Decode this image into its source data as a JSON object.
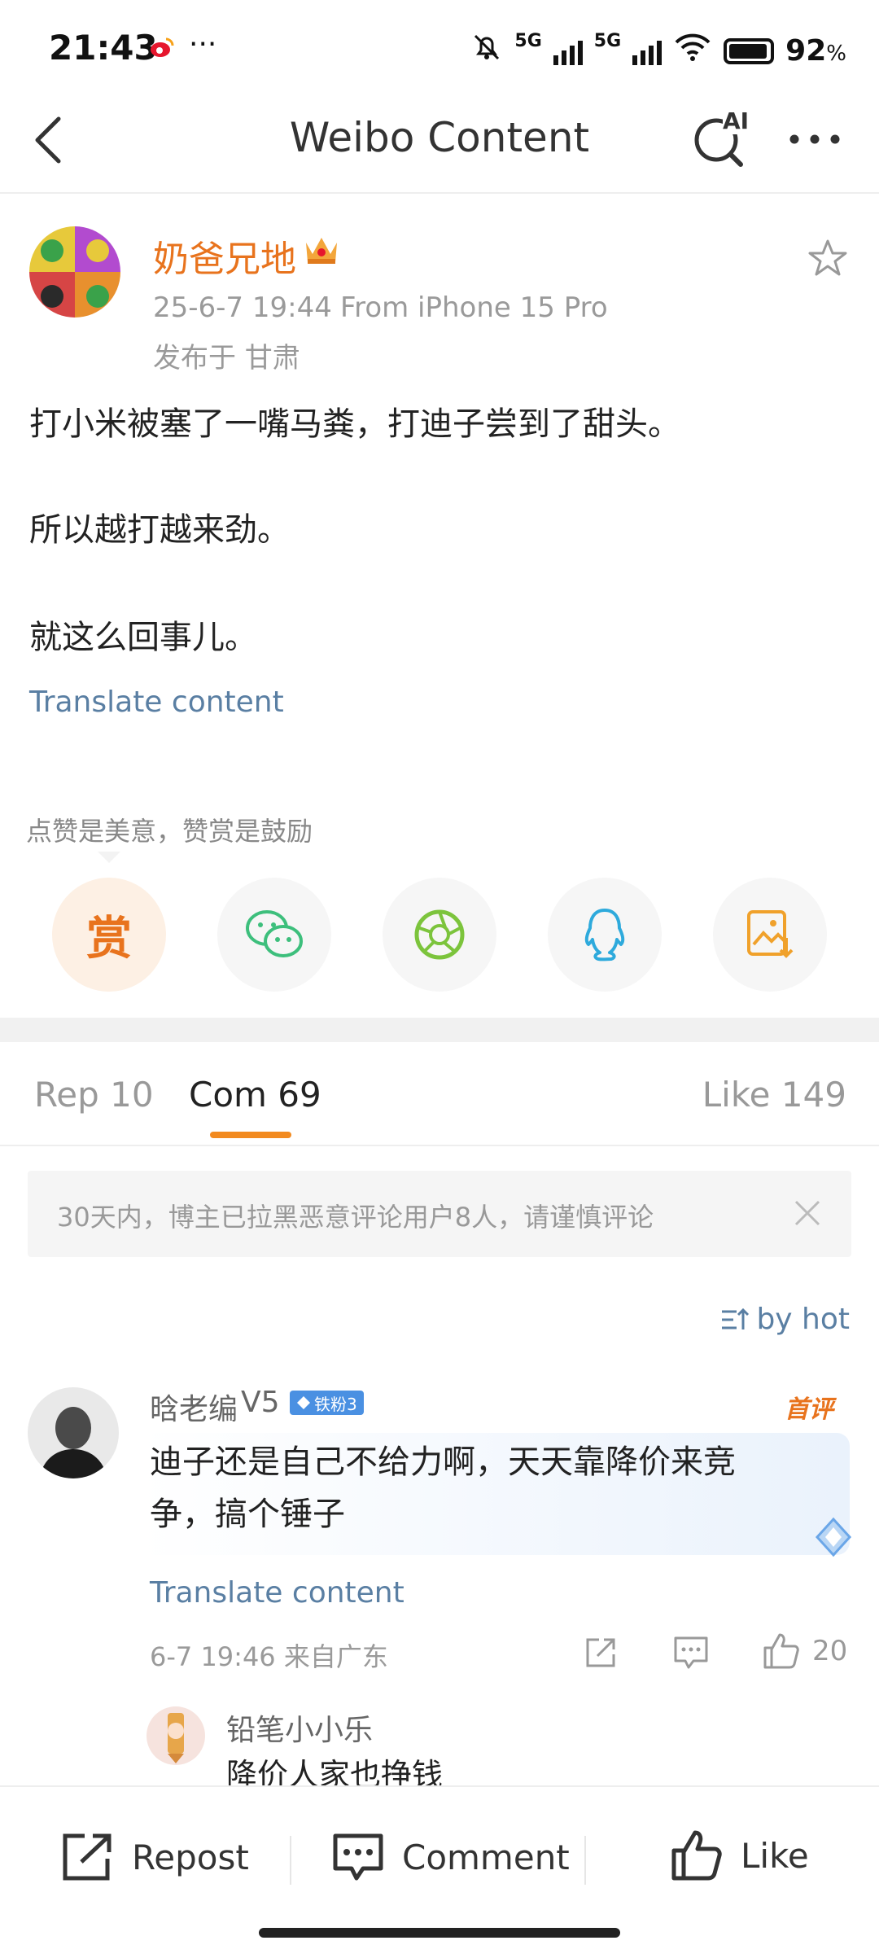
{
  "status": {
    "time": "21:43",
    "more": "···",
    "signal1": "5G",
    "signal2": "5G",
    "battery": "92",
    "battery_unit": "%"
  },
  "header": {
    "title": "Weibo Content",
    "ai_label": "AI"
  },
  "post": {
    "author": "奶爸兄地",
    "date": "25-6-7 19:44",
    "source": "From iPhone 15 Pro",
    "location": "发布于 甘肃",
    "paragraphs": [
      "打小米被塞了一嘴马粪，打迪子尝到了甜头。",
      "所以越打越来劲。",
      "就这么回事儿。"
    ],
    "translate": "Translate content"
  },
  "reward": {
    "tip": "点赞是美意，赞赏是鼓励",
    "reward_glyph": "赏"
  },
  "tabs": {
    "repost": "Rep 10",
    "comment": "Com 69",
    "like": "Like 149"
  },
  "notice": {
    "text": "30天内，博主已拉黑恶意评论用户8人，请谨慎评论"
  },
  "sort": {
    "label": "by hot"
  },
  "comment": {
    "author": "晗老编",
    "level": "V5",
    "fan_badge": "铁粉3",
    "first_badge": "首评",
    "text_line1": "迪子还是自己不给力啊，天天靠降价来竞",
    "text_line2": "争，搞个锤子",
    "translate": "Translate content",
    "time_loc": "6-7 19:46  来自广东",
    "likes": "20"
  },
  "reply": {
    "author": "铅笔小小乐",
    "text": "降价人家也挣钱"
  },
  "bottom": {
    "repost": "Repost",
    "comment": "Comment",
    "like": "Like"
  },
  "colors": {
    "accent": "#e8731d",
    "link": "#5a7fa3",
    "tab_indicator": "#f28a1f"
  }
}
